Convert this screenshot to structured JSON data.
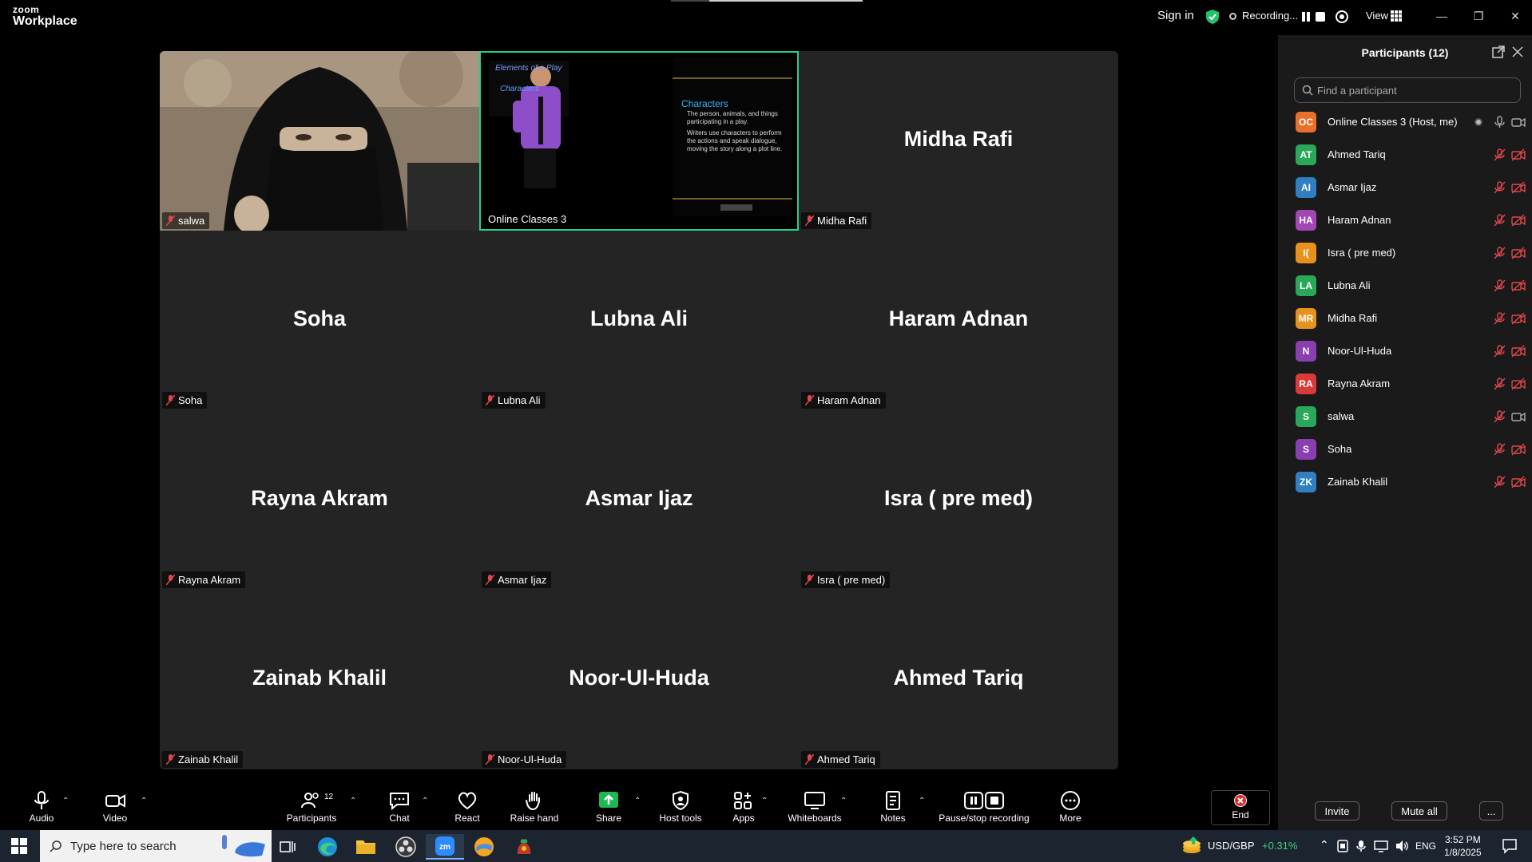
{
  "app": {
    "logo_line1": "zoom",
    "logo_line2": "Workplace",
    "sign_in": "Sign in",
    "recording_label": "Recording...",
    "view_label": "View"
  },
  "gallery": {
    "tiles": [
      {
        "label": "salwa",
        "big_name": ""
      },
      {
        "label": "Online Classes 3",
        "big_name": ""
      },
      {
        "label": "Midha Rafi",
        "big_name": "Midha Rafi"
      },
      {
        "label": "Soha",
        "big_name": "Soha"
      },
      {
        "label": "Lubna Ali",
        "big_name": "Lubna Ali"
      },
      {
        "label": "Haram Adnan",
        "big_name": "Haram Adnan"
      },
      {
        "label": "Rayna Akram",
        "big_name": "Rayna Akram"
      },
      {
        "label": "Asmar Ijaz",
        "big_name": "Asmar Ijaz"
      },
      {
        "label": "Isra ( pre med)",
        "big_name": "Isra ( pre med)"
      },
      {
        "label": "Zainab Khalil",
        "big_name": "Zainab Khalil"
      },
      {
        "label": "Noor-Ul-Huda",
        "big_name": "Noor-Ul-Huda"
      },
      {
        "label": "Ahmed Tariq",
        "big_name": "Ahmed Tariq"
      }
    ],
    "slide": {
      "heading": "Characters",
      "bullet1": "The person, animals, and things participating in a play.",
      "bullet2": "Writers use characters to perform the actions and speak dialogue, moving the story along a plot line.",
      "title_left": "Elements of a Play",
      "subtitle_left": "Characters"
    }
  },
  "participants_panel": {
    "title": "Participants (12)",
    "search_placeholder": "Find a participant",
    "invite_label": "Invite",
    "mute_all_label": "Mute all",
    "more_label": "...",
    "list": [
      {
        "initials": "OC",
        "name": "Online Classes 3 (Host, me)",
        "color": "#e8702a",
        "mic": "on",
        "cam": "on"
      },
      {
        "initials": "AT",
        "name": "Ahmed Tariq",
        "color": "#2aa85a",
        "mic": "off",
        "cam": "off"
      },
      {
        "initials": "AI",
        "name": "Asmar Ijaz",
        "color": "#2f7fc1",
        "mic": "off",
        "cam": "off"
      },
      {
        "initials": "HA",
        "name": "Haram Adnan",
        "color": "#a347b5",
        "mic": "off",
        "cam": "off"
      },
      {
        "initials": "I(",
        "name": "Isra ( pre med)",
        "color": "#e8921e",
        "mic": "off",
        "cam": "off"
      },
      {
        "initials": "LA",
        "name": "Lubna Ali",
        "color": "#2aa85a",
        "mic": "off",
        "cam": "off"
      },
      {
        "initials": "MR",
        "name": "Midha Rafi",
        "color": "#e8921e",
        "mic": "off",
        "cam": "off"
      },
      {
        "initials": "N",
        "name": "Noor-Ul-Huda",
        "color": "#8a3fb0",
        "mic": "off",
        "cam": "off"
      },
      {
        "initials": "RA",
        "name": "Rayna Akram",
        "color": "#d93a3a",
        "mic": "off",
        "cam": "off"
      },
      {
        "initials": "S",
        "name": "salwa",
        "color": "#2aa85a",
        "mic": "off",
        "cam": "on"
      },
      {
        "initials": "S",
        "name": "Soha",
        "color": "#8a3fb0",
        "mic": "off",
        "cam": "off"
      },
      {
        "initials": "ZK",
        "name": "Zainab Khalil",
        "color": "#2f7fc1",
        "mic": "off",
        "cam": "off"
      }
    ]
  },
  "toolbar": {
    "audio": "Audio",
    "video": "Video",
    "participants": "Participants",
    "participants_count": "12",
    "chat": "Chat",
    "react": "React",
    "raise_hand": "Raise hand",
    "share": "Share",
    "host_tools": "Host tools",
    "apps": "Apps",
    "whiteboards": "Whiteboards",
    "notes": "Notes",
    "pause_stop_recording": "Pause/stop recording",
    "more": "More",
    "end": "End"
  },
  "taskbar": {
    "search_text": "Type here to search",
    "ticker": "USD/GBP",
    "ticker_change": "+0.31%",
    "language": "ENG",
    "time": "3:52 PM",
    "date": "1/8/2025"
  },
  "colors": {
    "accent_green": "#23d18b",
    "share_green": "#1db954",
    "muted_red": "#e0474c",
    "end_red": "#e02828"
  }
}
